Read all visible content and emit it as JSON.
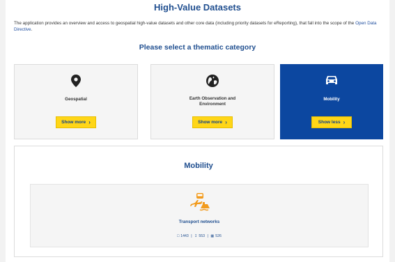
{
  "header": {
    "title": "High-Value Datasets",
    "intro_text": "The application provides an overview and access to geospatial high-value datasets and other core data (including priority datasets for eReporting), that fall into the scope of the ",
    "intro_link": "Open Data Directive",
    "intro_end": "."
  },
  "categories_heading": "Please select a thematic category",
  "categories": [
    {
      "label": "Geospatial",
      "button": "Show more",
      "icon": "location-pin-icon",
      "active": false
    },
    {
      "label": "Earth Observation and Environment",
      "button": "Show more",
      "icon": "globe-icon",
      "active": false
    },
    {
      "label": "Mobility",
      "button": "Show less",
      "icon": "car-icon",
      "active": true
    }
  ],
  "detail": {
    "title": "Mobility",
    "dataset": {
      "name": "Transport networks",
      "icon": "transport-networks-icon",
      "stat_datasets": "1443",
      "stat_downloads": "553",
      "stat_services": "526"
    }
  },
  "colors": {
    "primary_blue": "#0c47a0",
    "accent_yellow": "#ffd617",
    "icon_orange": "#f29b1d"
  }
}
